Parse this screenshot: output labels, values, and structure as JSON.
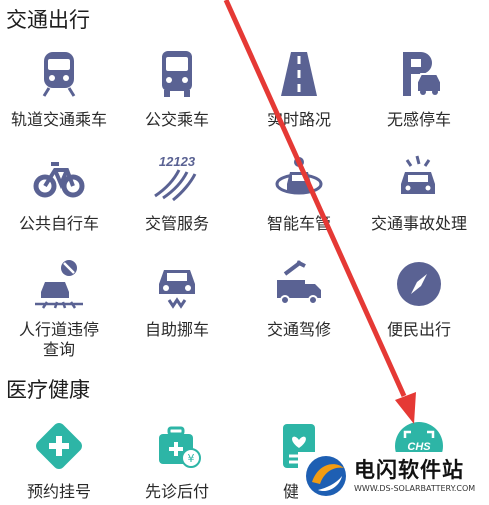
{
  "sections": [
    {
      "title": "交通出行"
    },
    {
      "title": "医疗健康"
    }
  ],
  "traffic": [
    {
      "label": "轨道交通乘车",
      "icon": "train-icon"
    },
    {
      "label": "公交乘车",
      "icon": "bus-icon"
    },
    {
      "label": "实时路况",
      "icon": "road-icon"
    },
    {
      "label": "无感停车",
      "icon": "parking-icon"
    },
    {
      "label": "公共自行车",
      "icon": "bicycle-icon"
    },
    {
      "label": "交管服务",
      "icon": "traffic-police-icon",
      "badge": "12123"
    },
    {
      "label": "智能车管",
      "icon": "smart-car-icon"
    },
    {
      "label": "交通事故处理",
      "icon": "car-accident-icon"
    },
    {
      "label": "人行道违停\n查询",
      "icon": "no-parking-icon"
    },
    {
      "label": "自助挪车",
      "icon": "tow-car-icon"
    },
    {
      "label": "交通驾修",
      "icon": "repair-truck-icon"
    },
    {
      "label": "便民出行",
      "icon": "compass-icon"
    }
  ],
  "health": [
    {
      "label": "预约挂号",
      "icon": "medical-cross-icon"
    },
    {
      "label": "先诊后付",
      "icon": "medical-kit-icon",
      "badge": "¥"
    },
    {
      "label": "健康",
      "icon": "health-record-icon"
    },
    {
      "label": "",
      "icon": "chs-scan-icon",
      "badge": "CHS"
    }
  ],
  "watermark": {
    "name": "电闪软件站",
    "url": "WWW.DS-SOLARBATTERY.COM"
  },
  "colors": {
    "icon": "#5a6293",
    "teal": "#2db5a6",
    "arrow": "#e53935"
  }
}
